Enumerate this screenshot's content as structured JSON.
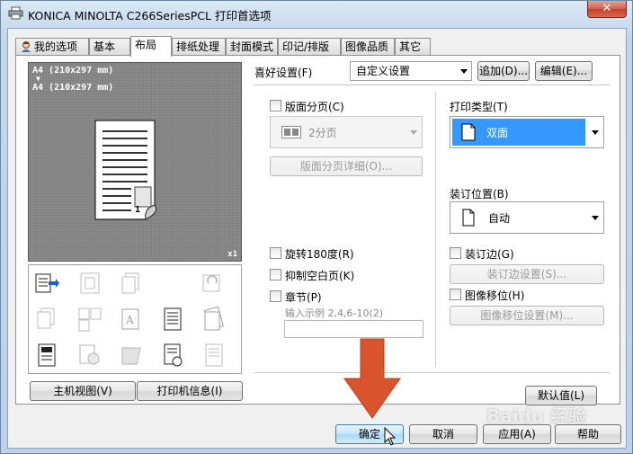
{
  "window": {
    "title": "KONICA MINOLTA C266SeriesPCL 打印首选项",
    "close_glyph": "✕"
  },
  "tabs": [
    {
      "label": "我的选项",
      "icon": "user-icon",
      "active": false
    },
    {
      "label": "基本",
      "active": false
    },
    {
      "label": "布局",
      "active": true
    },
    {
      "label": "排纸处理",
      "active": false
    },
    {
      "label": "封面模式",
      "active": false
    },
    {
      "label": "印记/排版",
      "active": false
    },
    {
      "label": "图像品质",
      "active": false
    },
    {
      "label": "其它",
      "active": false
    }
  ],
  "preview": {
    "line1": "A4  (210x297 mm)",
    "arrow": "▼",
    "line2": "A4  (210x297 mm)",
    "page_number": "1",
    "scale": "x1"
  },
  "favorites": {
    "label": "喜好设置(F)",
    "value": "自定义设置",
    "add_label": "追加(D)...",
    "edit_label": "编辑(E)..."
  },
  "left_buttons": {
    "host_view": "主机视图(V)",
    "printer_info": "打印机信息(I)"
  },
  "combination": {
    "checkbox_label": "版面分页(C)",
    "value": "2分页",
    "detail_button": "版面分页详细(O)..."
  },
  "print_type": {
    "label": "打印类型(T)",
    "value": "双面",
    "accent": "#3399ff"
  },
  "binding_position": {
    "label": "装订位置(B)",
    "value": "自动"
  },
  "options": {
    "rotate_label": "旋转180度(R)",
    "skip_blank_label": "抑制空白页(K)",
    "chapter_label": "章节(P)",
    "chapter_hint": "输入示例 2,4,6-10(2)"
  },
  "binding_margin": {
    "checkbox_label": "装订边(G)",
    "settings_button": "装订边设置(S)..."
  },
  "image_shift": {
    "checkbox_label": "图像移位(H)",
    "settings_button": "图像移位设置(M)..."
  },
  "default_button": "默认值(L)",
  "footer": {
    "ok": "确定",
    "cancel": "取消",
    "apply": "应用(A)",
    "help": "帮助"
  },
  "overlay": {
    "arrow_color": "#d9532c",
    "watermark": "Baidu 经验"
  }
}
